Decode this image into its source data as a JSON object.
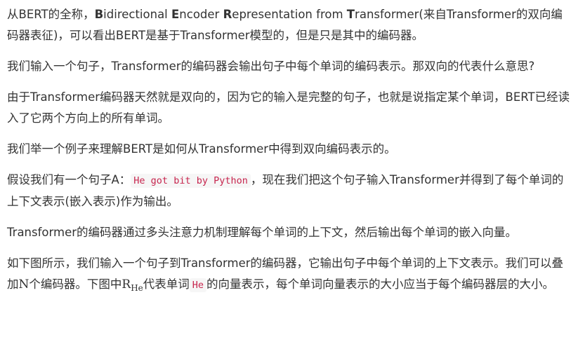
{
  "paragraphs": {
    "p1": {
      "prefix": "从BERT的全称，",
      "b1": "B",
      "t1": "idirectional ",
      "b2": "E",
      "t2": "ncoder ",
      "b3": "R",
      "t3": "epresentation from ",
      "b4": "T",
      "t4": "ransformer(来自Transformer的双向编码器表征)，可以看出BERT是基于Transformer模型的，但是只是其中的编码器。"
    },
    "p2": "我们输入一个句子，Transformer的编码器会输出句子中每个单词的编码表示。那双向的代表什么意思?",
    "p3": "由于Transformer编码器天然就是双向的，因为它的输入是完整的句子，也就是说指定某个单词，BERT已经读入了它两个方向上的所有单词。",
    "p4": "我们举一个例子来理解BERT是如何从Transformer中得到双向编码表示的。",
    "p5": {
      "before": "假设我们有一个句子A：",
      "code": "He got bit by Python",
      "after": "，现在我们把这个句子输入Transformer并得到了每个单词的上下文表示(嵌入表示)作为输出。"
    },
    "p6": "Transformer的编码器通过多头注意力机制理解每个单词的上下文，然后输出每个单词的嵌入向量。",
    "p7": {
      "before": "如下图所示，我们输入一个句子到Transformer的编码器，它输出句子中每个单词的上下文表示。我们可以叠加",
      "n_symbol": "N",
      "middle": "个编码器。下图中",
      "r_symbol": "R",
      "r_subscript": "He",
      "middle2": "代表单词",
      "code": "He",
      "after": "的向量表示，每个单词向量表示的大小应当于每个编码器层的大小。"
    }
  }
}
